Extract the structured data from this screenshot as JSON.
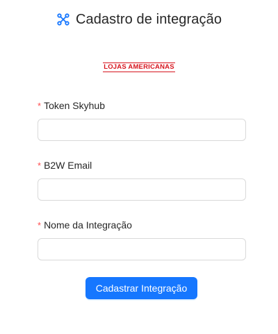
{
  "header": {
    "title": "Cadastro de integração",
    "icon": "api-icon",
    "icon_color": "#1677ff"
  },
  "logo": {
    "text": "LOJAS AMERICANAS",
    "color": "#d7141d"
  },
  "form": {
    "fields": [
      {
        "label": "Token Skyhub",
        "required_mark": "*",
        "value": "",
        "placeholder": ""
      },
      {
        "label": "B2W Email",
        "required_mark": "*",
        "value": "",
        "placeholder": ""
      },
      {
        "label": "Nome da Integração",
        "required_mark": "*",
        "value": "",
        "placeholder": ""
      }
    ],
    "submit_label": "Cadastrar Integração",
    "submit_color": "#1677ff"
  }
}
